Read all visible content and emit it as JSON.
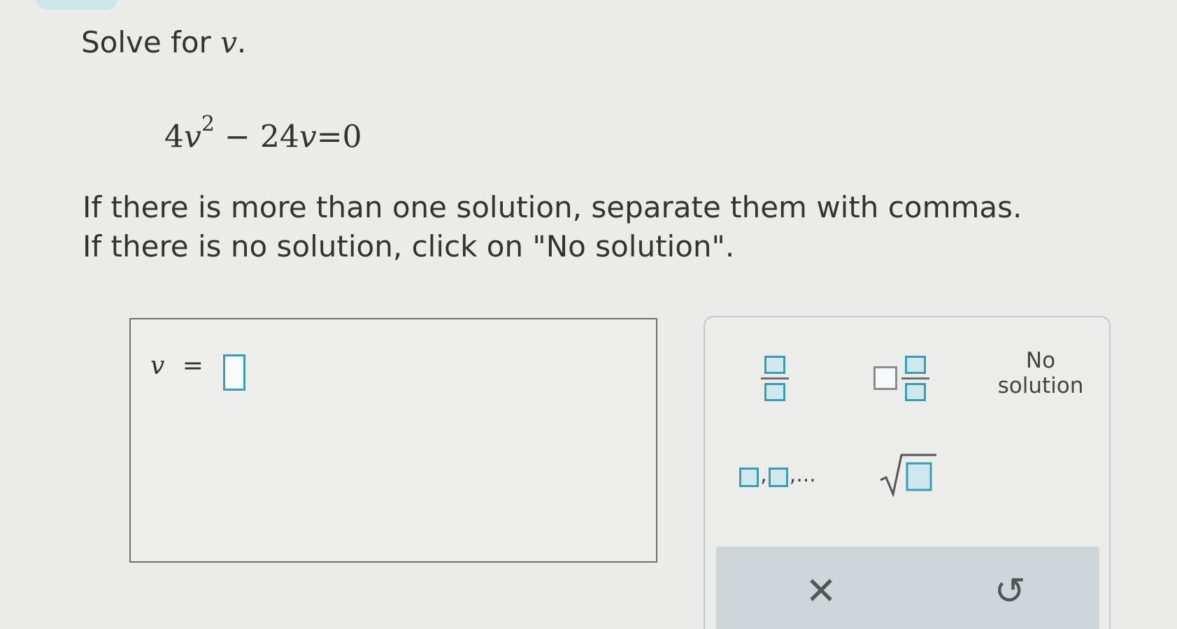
{
  "prompt": {
    "prefix": "Solve for",
    "variable": "v",
    "suffix": "."
  },
  "equation": {
    "coef1": "4",
    "var1": "v",
    "exp": "2",
    "op": "−",
    "coef2": "24",
    "var2": "v",
    "rest": "=0"
  },
  "instructions": {
    "line1": "If there is more than one solution, separate them with commas.",
    "line2": "If there is no solution, click on \"No solution\"."
  },
  "answer": {
    "variable": "v",
    "equals": "=",
    "value": ""
  },
  "keypad": {
    "no_solution_line1": "No",
    "no_solution_line2": "solution",
    "list_suffix": ",...",
    "list_comma": ",",
    "clear_glyph": "✕",
    "undo_glyph": "↺"
  },
  "colors": {
    "accent": "#3b9db4",
    "background": "#ebebea",
    "keypad_bar": "#cdd6d8"
  }
}
